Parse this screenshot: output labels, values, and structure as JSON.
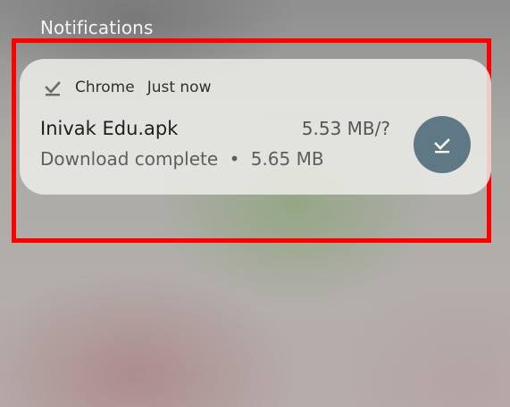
{
  "header": {
    "title": "Notifications"
  },
  "notification": {
    "app_name": "Chrome",
    "time": "Just now",
    "title": "Inivak Edu.apk",
    "size_progress": "5.53 MB/?",
    "status": "Download complete",
    "separator": "•",
    "file_size": "5.65 MB",
    "app_icon": "download-done-icon",
    "action_icon": "download-done-icon",
    "action_color": "#5f7886"
  },
  "highlight_color": "#ff0000"
}
